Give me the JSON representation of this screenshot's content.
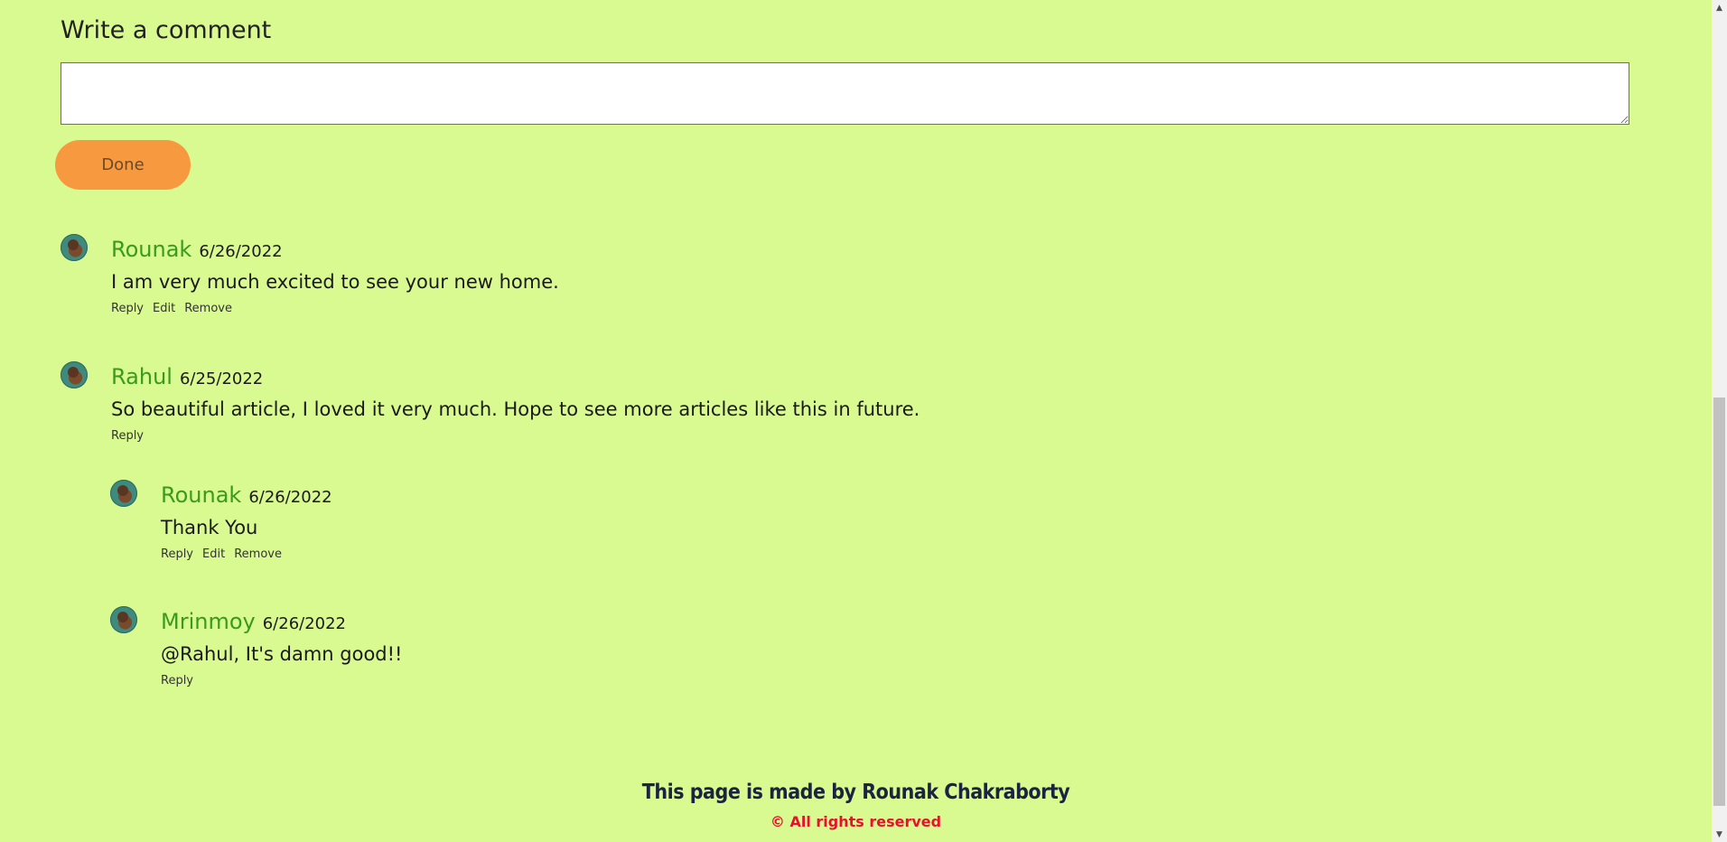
{
  "comment_form": {
    "heading": "Write a comment",
    "input_value": "",
    "done_label": "Done"
  },
  "comments": [
    {
      "author": "Rounak",
      "date": "6/26/2022",
      "text": "I am very much excited to see your new home.",
      "actions": [
        "Reply",
        "Edit",
        "Remove"
      ]
    },
    {
      "author": "Rahul",
      "date": "6/25/2022",
      "text": "So beautiful article, I loved it very much. Hope to see more articles like this in future.",
      "actions": [
        "Reply"
      ]
    },
    {
      "author": "Rounak",
      "date": "6/26/2022",
      "text": "Thank You",
      "actions": [
        "Reply",
        "Edit",
        "Remove"
      ]
    },
    {
      "author": "Mrinmoy",
      "date": "6/26/2022",
      "text": "@Rahul, It's damn good!!",
      "actions": [
        "Reply"
      ]
    }
  ],
  "footer": {
    "credit": "This page is made by Rounak Chakraborty",
    "rights": "© All rights reserved"
  },
  "icons": {
    "avatar": "avatar-icon",
    "scroll_up": "scroll-up-icon",
    "scroll_down": "scroll-down-icon"
  }
}
